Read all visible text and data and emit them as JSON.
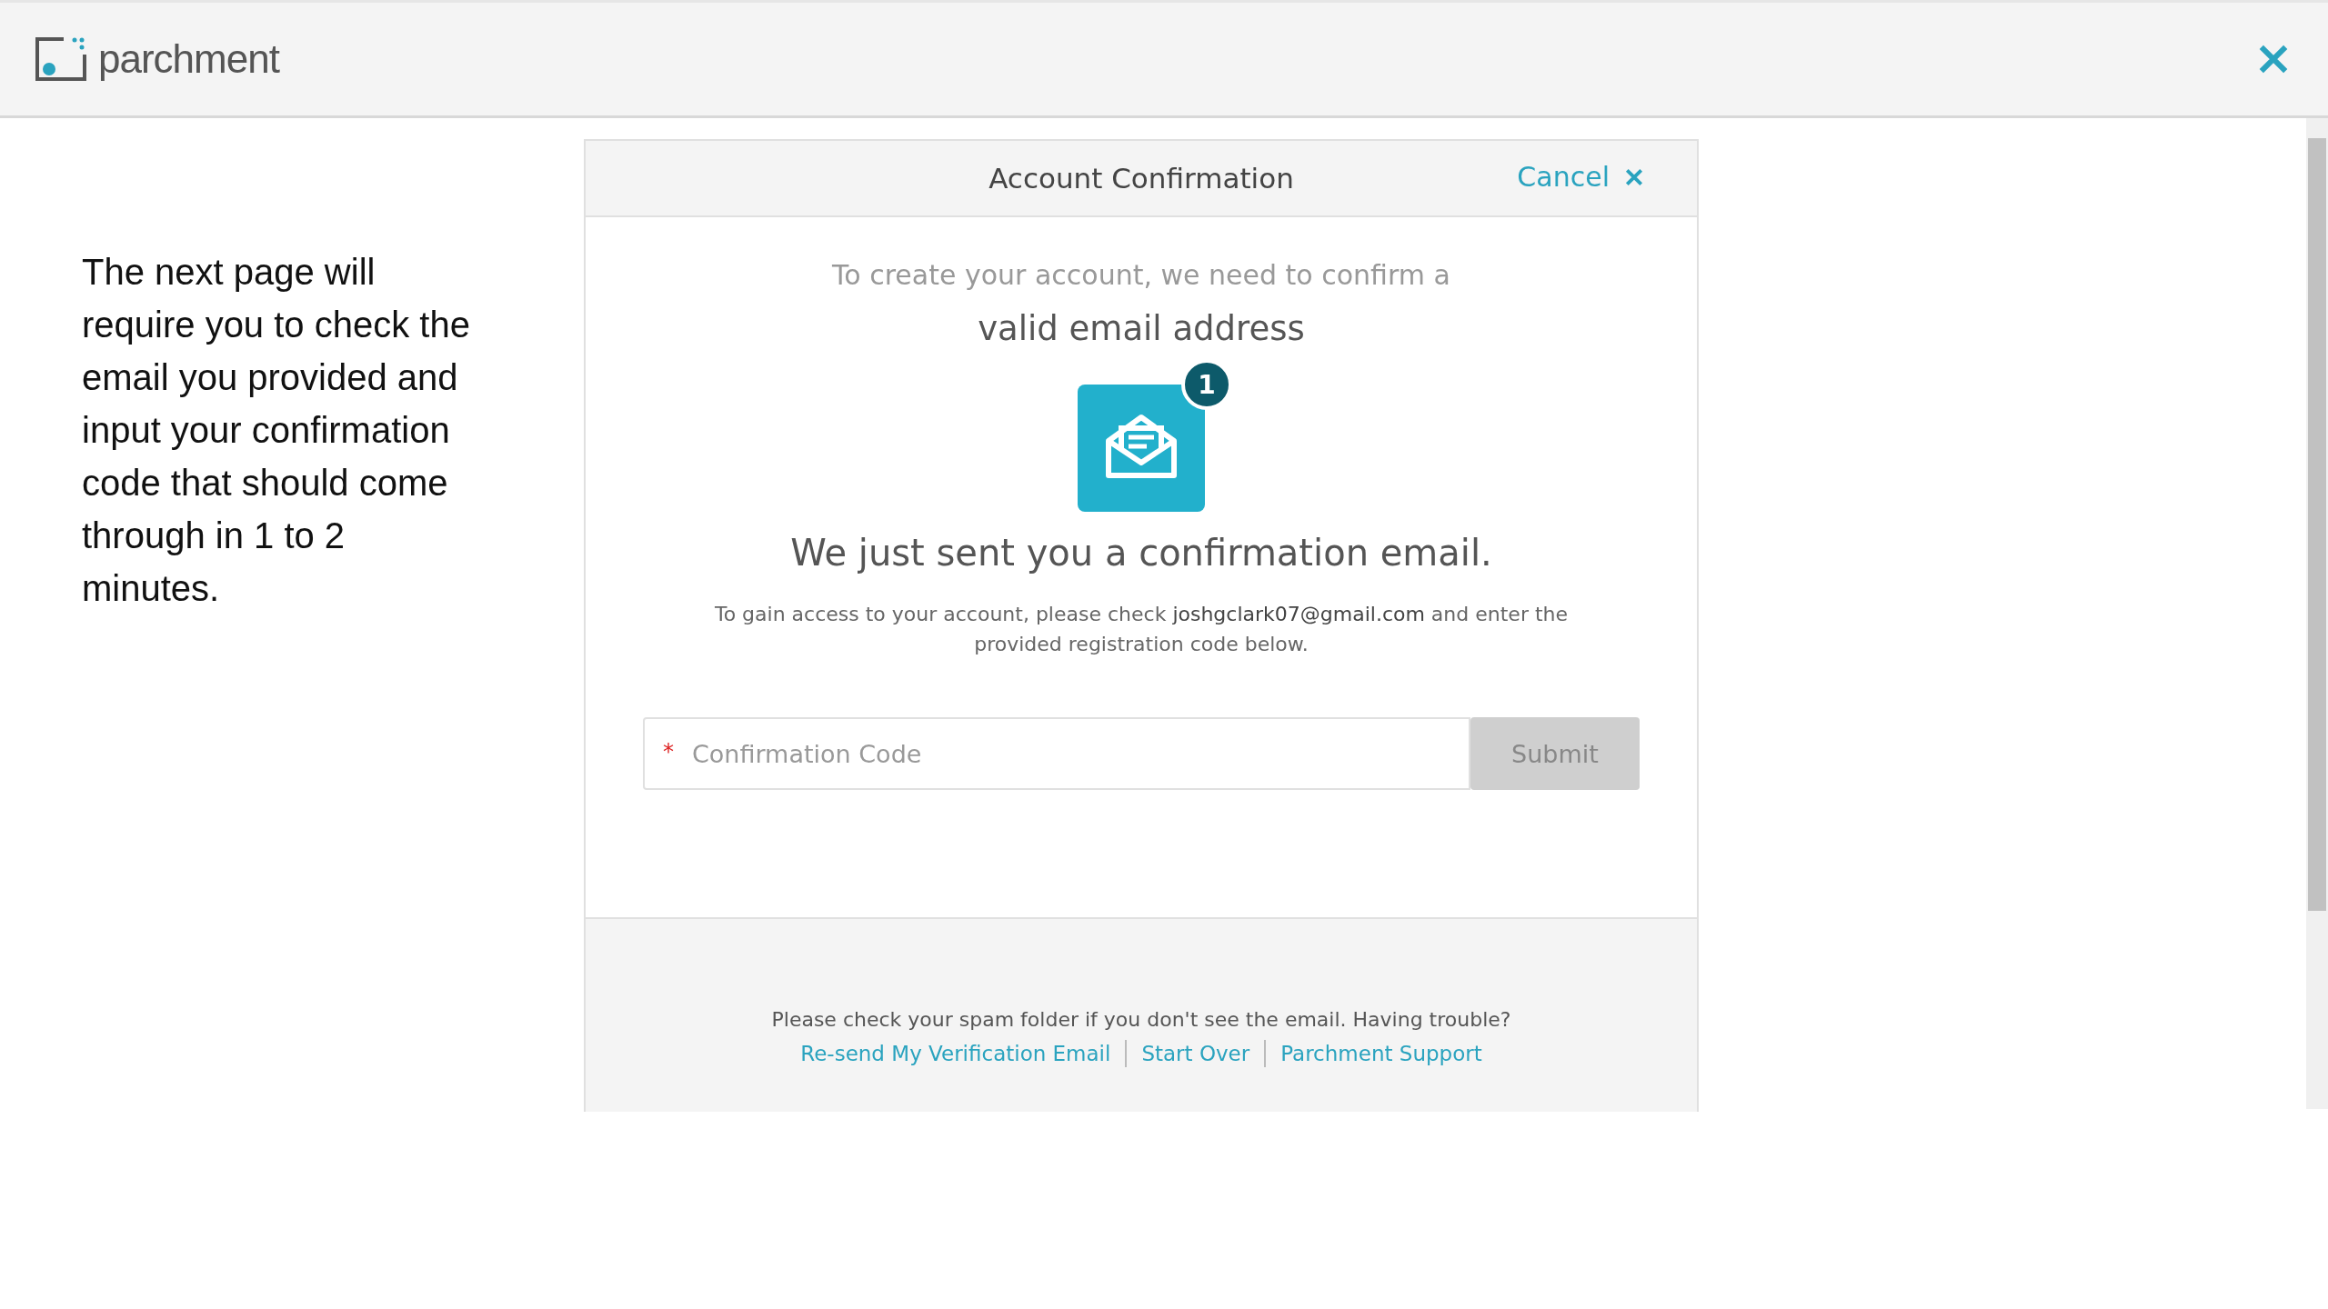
{
  "header": {
    "logo_text": "parchment"
  },
  "instruction": "The next page will require you to check the email you provided and input your confirmation code that should come through in 1 to 2 minutes.",
  "dialog": {
    "title": "Account Confirmation",
    "cancel": "Cancel",
    "subtitle": "To create your account, we need to confirm a",
    "subtitle_strong": "valid email address",
    "badge": "1",
    "heading": "We just sent you a confirmation email.",
    "message": "To gain access to your account, please check **joshgclark07@gmail.com** and enter the provided registration code below.",
    "field": {
      "required_mark": "*",
      "placeholder": "Confirmation Code"
    },
    "submit": {
      "label": "Submit",
      "disabled": true
    },
    "footer_note": "Please check your spam folder if you don't see the email. Having trouble?",
    "links": [
      "Re-send My Verification Email",
      "Start Over",
      "Parchment Support"
    ]
  }
}
